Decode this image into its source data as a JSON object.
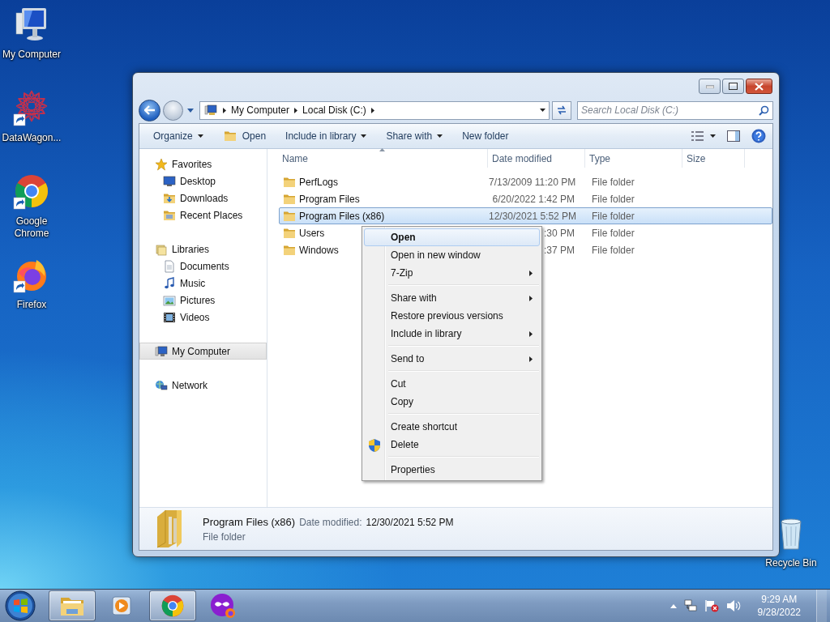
{
  "desktop_icons": [
    {
      "label": "My Computer",
      "kind": "computer",
      "shortcut": false
    },
    {
      "label": "DataWagon...",
      "kind": "datawagon",
      "shortcut": true
    },
    {
      "label": "Google Chrome",
      "kind": "chrome",
      "shortcut": true
    },
    {
      "label": "Firefox",
      "kind": "firefox",
      "shortcut": true
    }
  ],
  "recycle_bin": {
    "label": "Recycle Bin"
  },
  "window": {
    "address": {
      "segments": [
        "My Computer",
        "Local Disk (C:)"
      ]
    },
    "search": {
      "placeholder": "Search Local Disk (C:)"
    },
    "toolbar": [
      {
        "label": "Organize",
        "kind": "menu"
      },
      {
        "label": "Open",
        "kind": "folder"
      },
      {
        "label": "Include in library",
        "kind": "menu"
      },
      {
        "label": "Share with",
        "kind": "menu"
      },
      {
        "label": "New folder",
        "kind": "plain"
      }
    ],
    "navigation": [
      {
        "label": "Favorites",
        "kind": "star",
        "selected": false,
        "children": [
          {
            "label": "Desktop",
            "kind": "desktop",
            "selected": false
          },
          {
            "label": "Downloads",
            "kind": "downloads",
            "selected": false
          },
          {
            "label": "Recent Places",
            "kind": "recent",
            "selected": false
          }
        ]
      },
      {
        "label": "Libraries",
        "kind": "library",
        "selected": false,
        "children": [
          {
            "label": "Documents",
            "kind": "document",
            "selected": false
          },
          {
            "label": "Music",
            "kind": "music",
            "selected": false
          },
          {
            "label": "Pictures",
            "kind": "pictures",
            "selected": false
          },
          {
            "label": "Videos",
            "kind": "videos",
            "selected": false
          }
        ]
      },
      {
        "label": "My Computer",
        "kind": "computer",
        "selected": true
      },
      {
        "label": "Network",
        "kind": "network",
        "selected": false
      }
    ],
    "columns": [
      "Name",
      "Date modified",
      "Type",
      "Size"
    ],
    "rows": [
      {
        "name": "PerfLogs",
        "date_modified": "7/13/2009 11:20 PM",
        "type": "File folder",
        "selected": false
      },
      {
        "name": "Program Files",
        "date_modified": "6/20/2022 1:42 PM",
        "type": "File folder",
        "selected": false
      },
      {
        "name": "Program Files (x86)",
        "date_modified": "12/30/2021 5:52 PM",
        "type": "File folder",
        "selected": true
      },
      {
        "name": "Users",
        "date_modified": ":30 PM",
        "type": "File folder",
        "selected": false
      },
      {
        "name": "Windows",
        "date_modified": ":37 PM",
        "type": "File folder",
        "selected": false
      }
    ],
    "details": {
      "name": "Program Files (x86)",
      "date_label": "Date modified:",
      "date": "12/30/2021 5:52 PM",
      "type": "File folder"
    }
  },
  "context_menu": {
    "groups": [
      [
        {
          "label": "Open",
          "bold": true,
          "highlighted": true,
          "submenu": false,
          "shield": false
        },
        {
          "label": "Open in new window",
          "bold": false,
          "highlighted": false,
          "submenu": false,
          "shield": false
        },
        {
          "label": "7-Zip",
          "bold": false,
          "highlighted": false,
          "submenu": true,
          "shield": false
        }
      ],
      [
        {
          "label": "Share with",
          "bold": false,
          "highlighted": false,
          "submenu": true,
          "shield": false
        },
        {
          "label": "Restore previous versions",
          "bold": false,
          "highlighted": false,
          "submenu": false,
          "shield": false
        },
        {
          "label": "Include in library",
          "bold": false,
          "highlighted": false,
          "submenu": true,
          "shield": false
        }
      ],
      [
        {
          "label": "Send to",
          "bold": false,
          "highlighted": false,
          "submenu": true,
          "shield": false
        }
      ],
      [
        {
          "label": "Cut",
          "bold": false,
          "highlighted": false,
          "submenu": false,
          "shield": false
        },
        {
          "label": "Copy",
          "bold": false,
          "highlighted": false,
          "submenu": false,
          "shield": false
        }
      ],
      [
        {
          "label": "Create shortcut",
          "bold": false,
          "highlighted": false,
          "submenu": false,
          "shield": false
        },
        {
          "label": "Delete",
          "bold": false,
          "highlighted": false,
          "submenu": false,
          "shield": true
        }
      ],
      [
        {
          "label": "Properties",
          "bold": false,
          "highlighted": false,
          "submenu": false,
          "shield": false
        }
      ]
    ]
  },
  "taskbar": {
    "items": [
      {
        "kind": "explorer",
        "open": true
      },
      {
        "kind": "media",
        "open": false
      },
      {
        "kind": "chrome",
        "open": true
      },
      {
        "kind": "mask",
        "open": false
      }
    ],
    "time": "9:29 AM",
    "date": "9/28/2022"
  }
}
